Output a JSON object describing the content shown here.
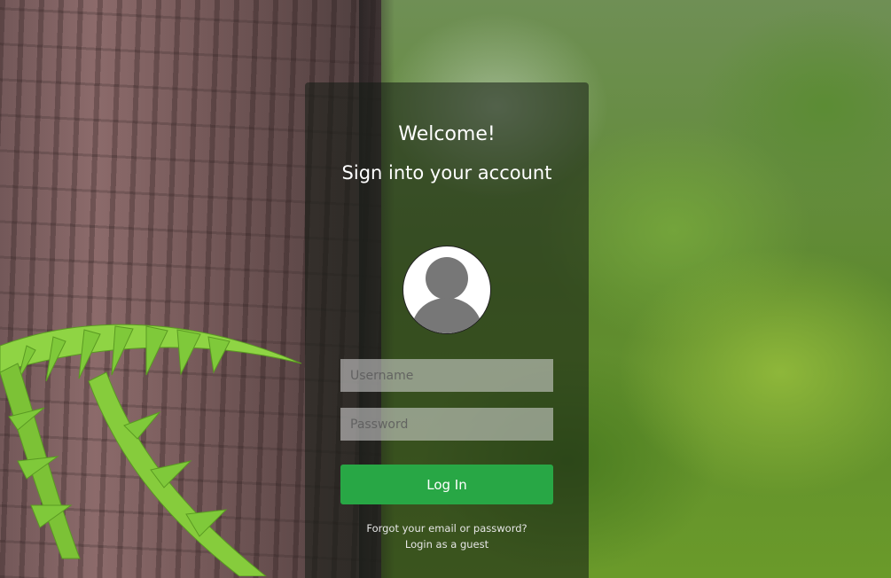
{
  "login": {
    "title": "Welcome!",
    "subtitle": "Sign into your account",
    "username_placeholder": "Username",
    "password_placeholder": "Password",
    "login_label": "Log In",
    "forgot_label": "Forgot your email or password?",
    "guest_label": "Login as a guest"
  },
  "colors": {
    "button": "#28a745",
    "card_overlay": "rgba(20,28,20,0.55)",
    "avatar_silhouette": "#777777"
  },
  "icons": {
    "avatar": "user-silhouette-icon"
  }
}
